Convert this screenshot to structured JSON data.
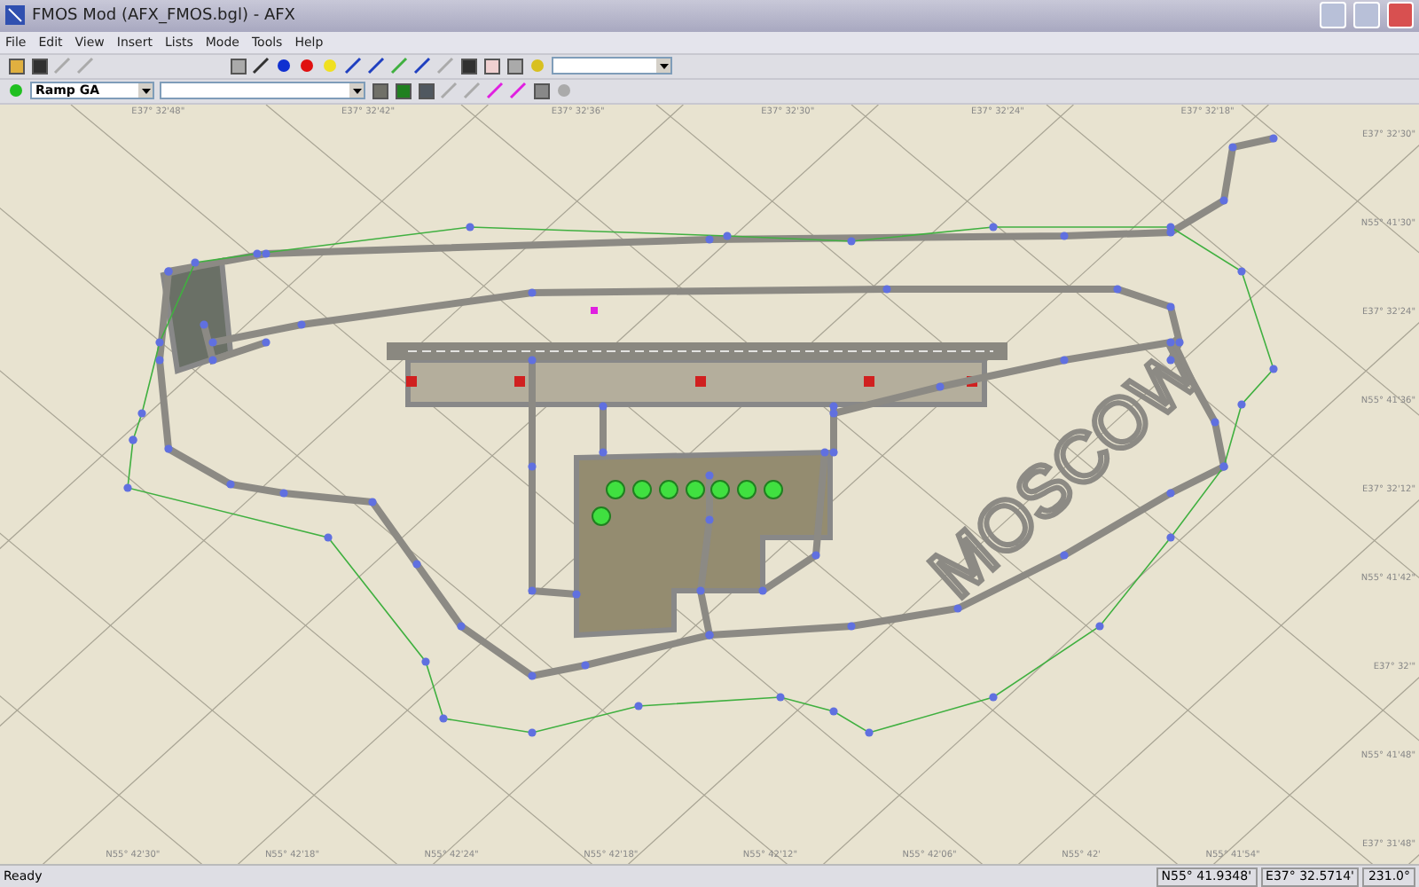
{
  "window": {
    "title": "FMOS Mod  (AFX_FMOS.bgl) - AFX"
  },
  "menu": [
    "File",
    "Edit",
    "View",
    "Insert",
    "Lists",
    "Mode",
    "Tools",
    "Help"
  ],
  "toolbar": {
    "layer_combo": {
      "value": "Ramp GA"
    }
  },
  "map": {
    "painted_text": "MOSCOW",
    "grid_labels_top": [
      "E37° 32'48\"",
      "E37° 32'42\"",
      "E37° 32'36\"",
      "E37° 32'30\"",
      "E37° 32'24\"",
      "E37° 32'18\""
    ],
    "grid_labels_right": [
      "E37° 32'30\"",
      "N55° 41'30\"",
      "E37° 32'24\"",
      "N55° 41'36\"",
      "E37° 32'12\"",
      "N55° 41'42\"",
      "E37° 32'\"",
      "N55° 41'48\"",
      "E37° 31'48\""
    ],
    "grid_labels_bottom": [
      "N55° 42'30\"",
      "N55° 42'18\"",
      "N55° 42'24\"",
      "N55° 42'18\"",
      "N55° 42'12\"",
      "N55° 42'06\"",
      "N55° 42'",
      "N55° 41'54\""
    ]
  },
  "status_bar": {
    "message": "Ready",
    "latitude": "N55° 41.9348'",
    "longitude": "E37° 32.5714'",
    "heading": "231.0°"
  }
}
